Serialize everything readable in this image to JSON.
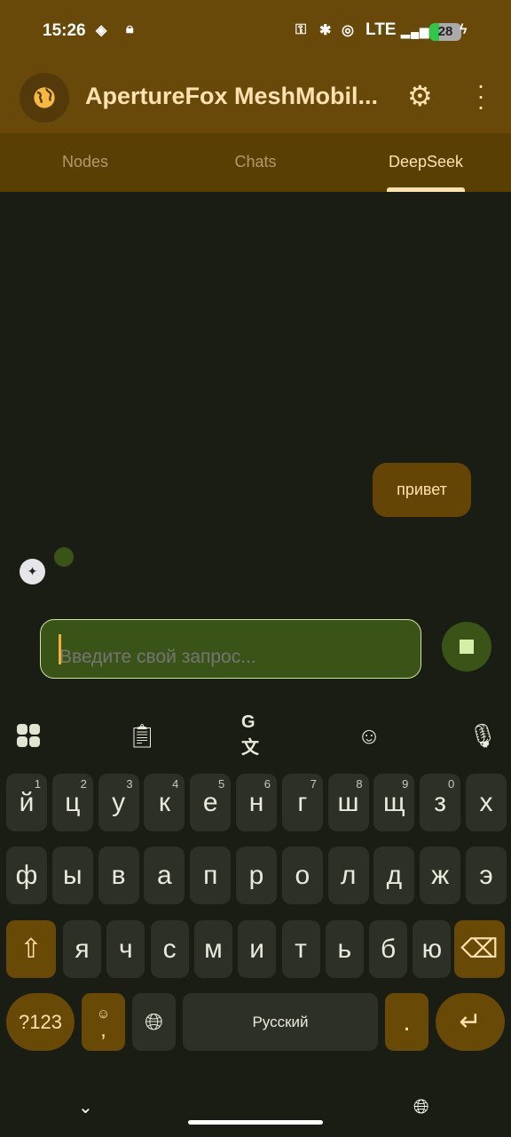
{
  "status_bar": {
    "time": "15:26",
    "network": "LTE",
    "battery": "28"
  },
  "app_bar": {
    "title": "ApertureFox MeshMobil...",
    "icons": [
      "globe-icon",
      "settings-icon",
      "more-vert-icon"
    ]
  },
  "tabs": [
    {
      "label": "Nodes"
    },
    {
      "label": "Chats"
    },
    {
      "label": "DeepSeek",
      "active": true
    }
  ],
  "chat": {
    "messages": [
      {
        "role": "user",
        "text": "привет"
      }
    ]
  },
  "composer": {
    "placeholder": "Введите свой запрос...",
    "value": ""
  },
  "keyboard": {
    "row1": [
      {
        "k": "й",
        "h": "1"
      },
      {
        "k": "ц",
        "h": "2"
      },
      {
        "k": "у",
        "h": "3"
      },
      {
        "k": "к",
        "h": "4"
      },
      {
        "k": "е",
        "h": "5"
      },
      {
        "k": "н",
        "h": "6"
      },
      {
        "k": "г",
        "h": "7"
      },
      {
        "k": "ш",
        "h": "8"
      },
      {
        "k": "щ",
        "h": "9"
      },
      {
        "k": "з",
        "h": "0"
      },
      {
        "k": "х",
        "h": ""
      }
    ],
    "row2": [
      "ф",
      "ы",
      "в",
      "а",
      "п",
      "р",
      "о",
      "л",
      "д",
      "ж",
      "э"
    ],
    "row3": [
      "я",
      "ч",
      "с",
      "м",
      "и",
      "т",
      "ь",
      "б",
      "ю"
    ],
    "symbols": "?123",
    "comma": ",",
    "space": "Русский",
    "period": "."
  },
  "colors": {
    "accent": "#684909",
    "input_bg": "#3a5417",
    "background": "#1a1d13"
  }
}
